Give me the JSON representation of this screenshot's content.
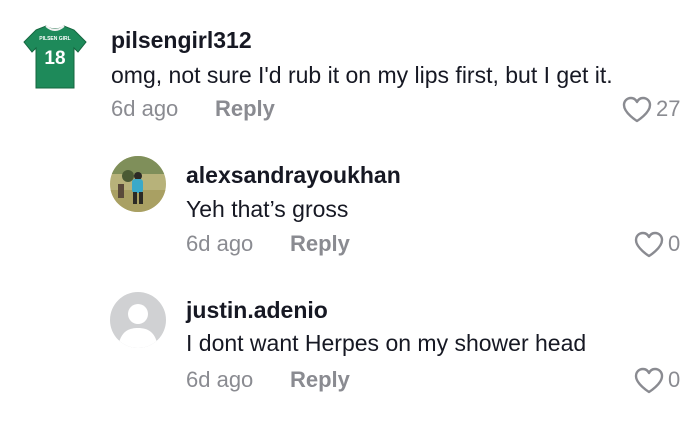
{
  "comments": [
    {
      "username": "pilsengirl312",
      "text": "omg, not sure I'd rub it on my lips first, but I get it.",
      "time": "6d ago",
      "reply_label": "Reply",
      "likes": "27",
      "avatar": {
        "jersey_label": "PILSEN GIRL",
        "jersey_number": "18",
        "color": "#1e8a5a"
      }
    },
    {
      "username": "alexsandrayoukhan",
      "text": "Yeh that’s gross",
      "time": "6d ago",
      "reply_label": "Reply",
      "likes": "0"
    },
    {
      "username": "justin.adenio",
      "text": "I dont want Herpes on my shower head",
      "time": "6d ago",
      "reply_label": "Reply",
      "likes": "0"
    }
  ],
  "colors": {
    "text_primary": "#161823",
    "text_secondary": "#8a8b91",
    "background": "#ffffff"
  }
}
